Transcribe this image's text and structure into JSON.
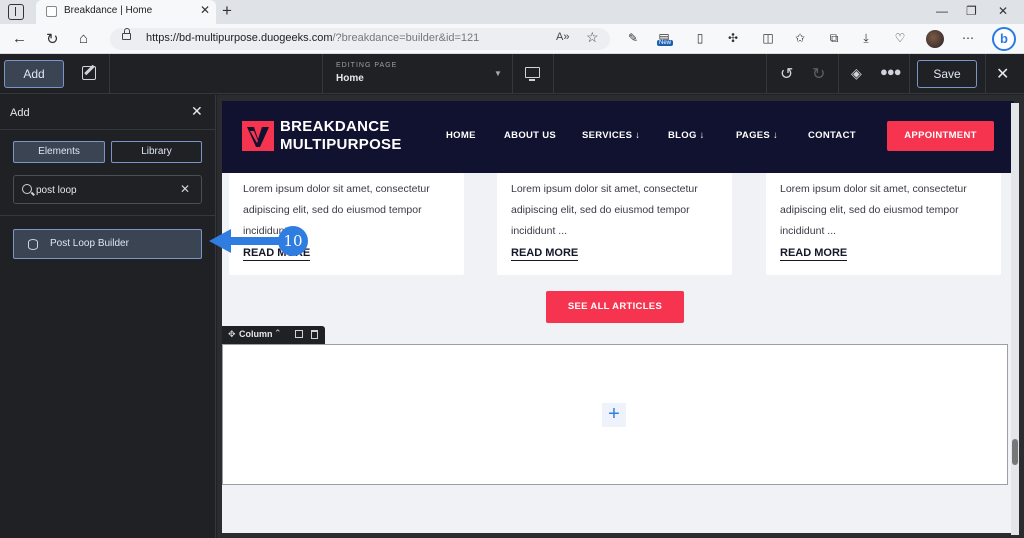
{
  "browser": {
    "tab_title": "Breakdance | Home",
    "url_host": "https://bd-multipurpose.duogeeks.com",
    "url_query": "/?breakdance=builder&id=121",
    "new_badge": "New"
  },
  "builder": {
    "add_label": "Add",
    "editing_label": "EDITING PAGE",
    "editing_page": "Home",
    "save_label": "Save"
  },
  "panel": {
    "title": "Add",
    "tab_elements": "Elements",
    "tab_library": "Library",
    "search_value": "post loop",
    "result_label": "Post Loop Builder"
  },
  "annotation": {
    "step": "10",
    "color": "#2f7de1"
  },
  "site": {
    "logo_line1": "BREAKDANCE",
    "logo_line2": "MULTIPURPOSE",
    "nav": [
      "HOME",
      "ABOUT US",
      "SERVICES ↓",
      "BLOG ↓",
      "PAGES ↓",
      "CONTACT"
    ],
    "cta": "APPOINTMENT",
    "cards": [
      {
        "text": "Lorem ipsum dolor sit amet, consectetur adipiscing elit, sed do eiusmod tempor incididunt ...",
        "link": "READ MORE"
      },
      {
        "text": "Lorem ipsum dolor sit amet, consectetur adipiscing elit, sed do eiusmod tempor incididunt ...",
        "link": "READ MORE"
      },
      {
        "text": "Lorem ipsum dolor sit amet, consectetur adipiscing elit, sed do eiusmod tempor incididunt ...",
        "link": "READ MORE"
      }
    ],
    "see_all": "SEE ALL ARTICLES",
    "column_label": "Column",
    "accent_color": "#f6344f",
    "header_color": "#111230"
  }
}
